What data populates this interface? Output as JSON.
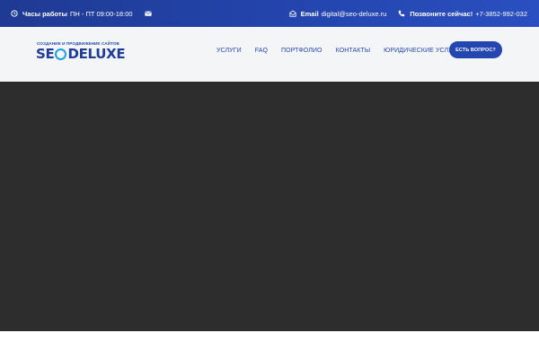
{
  "topbar": {
    "hours_label": "Часы работы",
    "hours_value": "ПН - ПТ 09:00-18:00",
    "email_label": "Email",
    "email_value": "digital@seo-deluxe.ru",
    "phone_label": "Позвоните сейчас!",
    "phone_value": "+7-3852-992-032",
    "icons": [
      "clock-icon",
      "envelope-icon",
      "envelope-outline-icon",
      "phone-icon"
    ]
  },
  "logo": {
    "tagline": "СОЗДАНИЕ И ПРОДВИЖЕНИЕ САЙТОВ",
    "word_left": "SE",
    "word_right": "DELUXE"
  },
  "nav": {
    "items": [
      "Услуги",
      "FAQ",
      "Портфолио",
      "Контакты",
      "Юридические услуги"
    ]
  },
  "cta": {
    "label": "ЕСТЬ ВОПРОС?"
  },
  "colors": {
    "topbar": "#2446b0",
    "header_bg": "#f4f5f7",
    "hero_bg": "#2d2d2d",
    "accent": "#2446b0",
    "logo_globe": "#1aa3e0"
  }
}
